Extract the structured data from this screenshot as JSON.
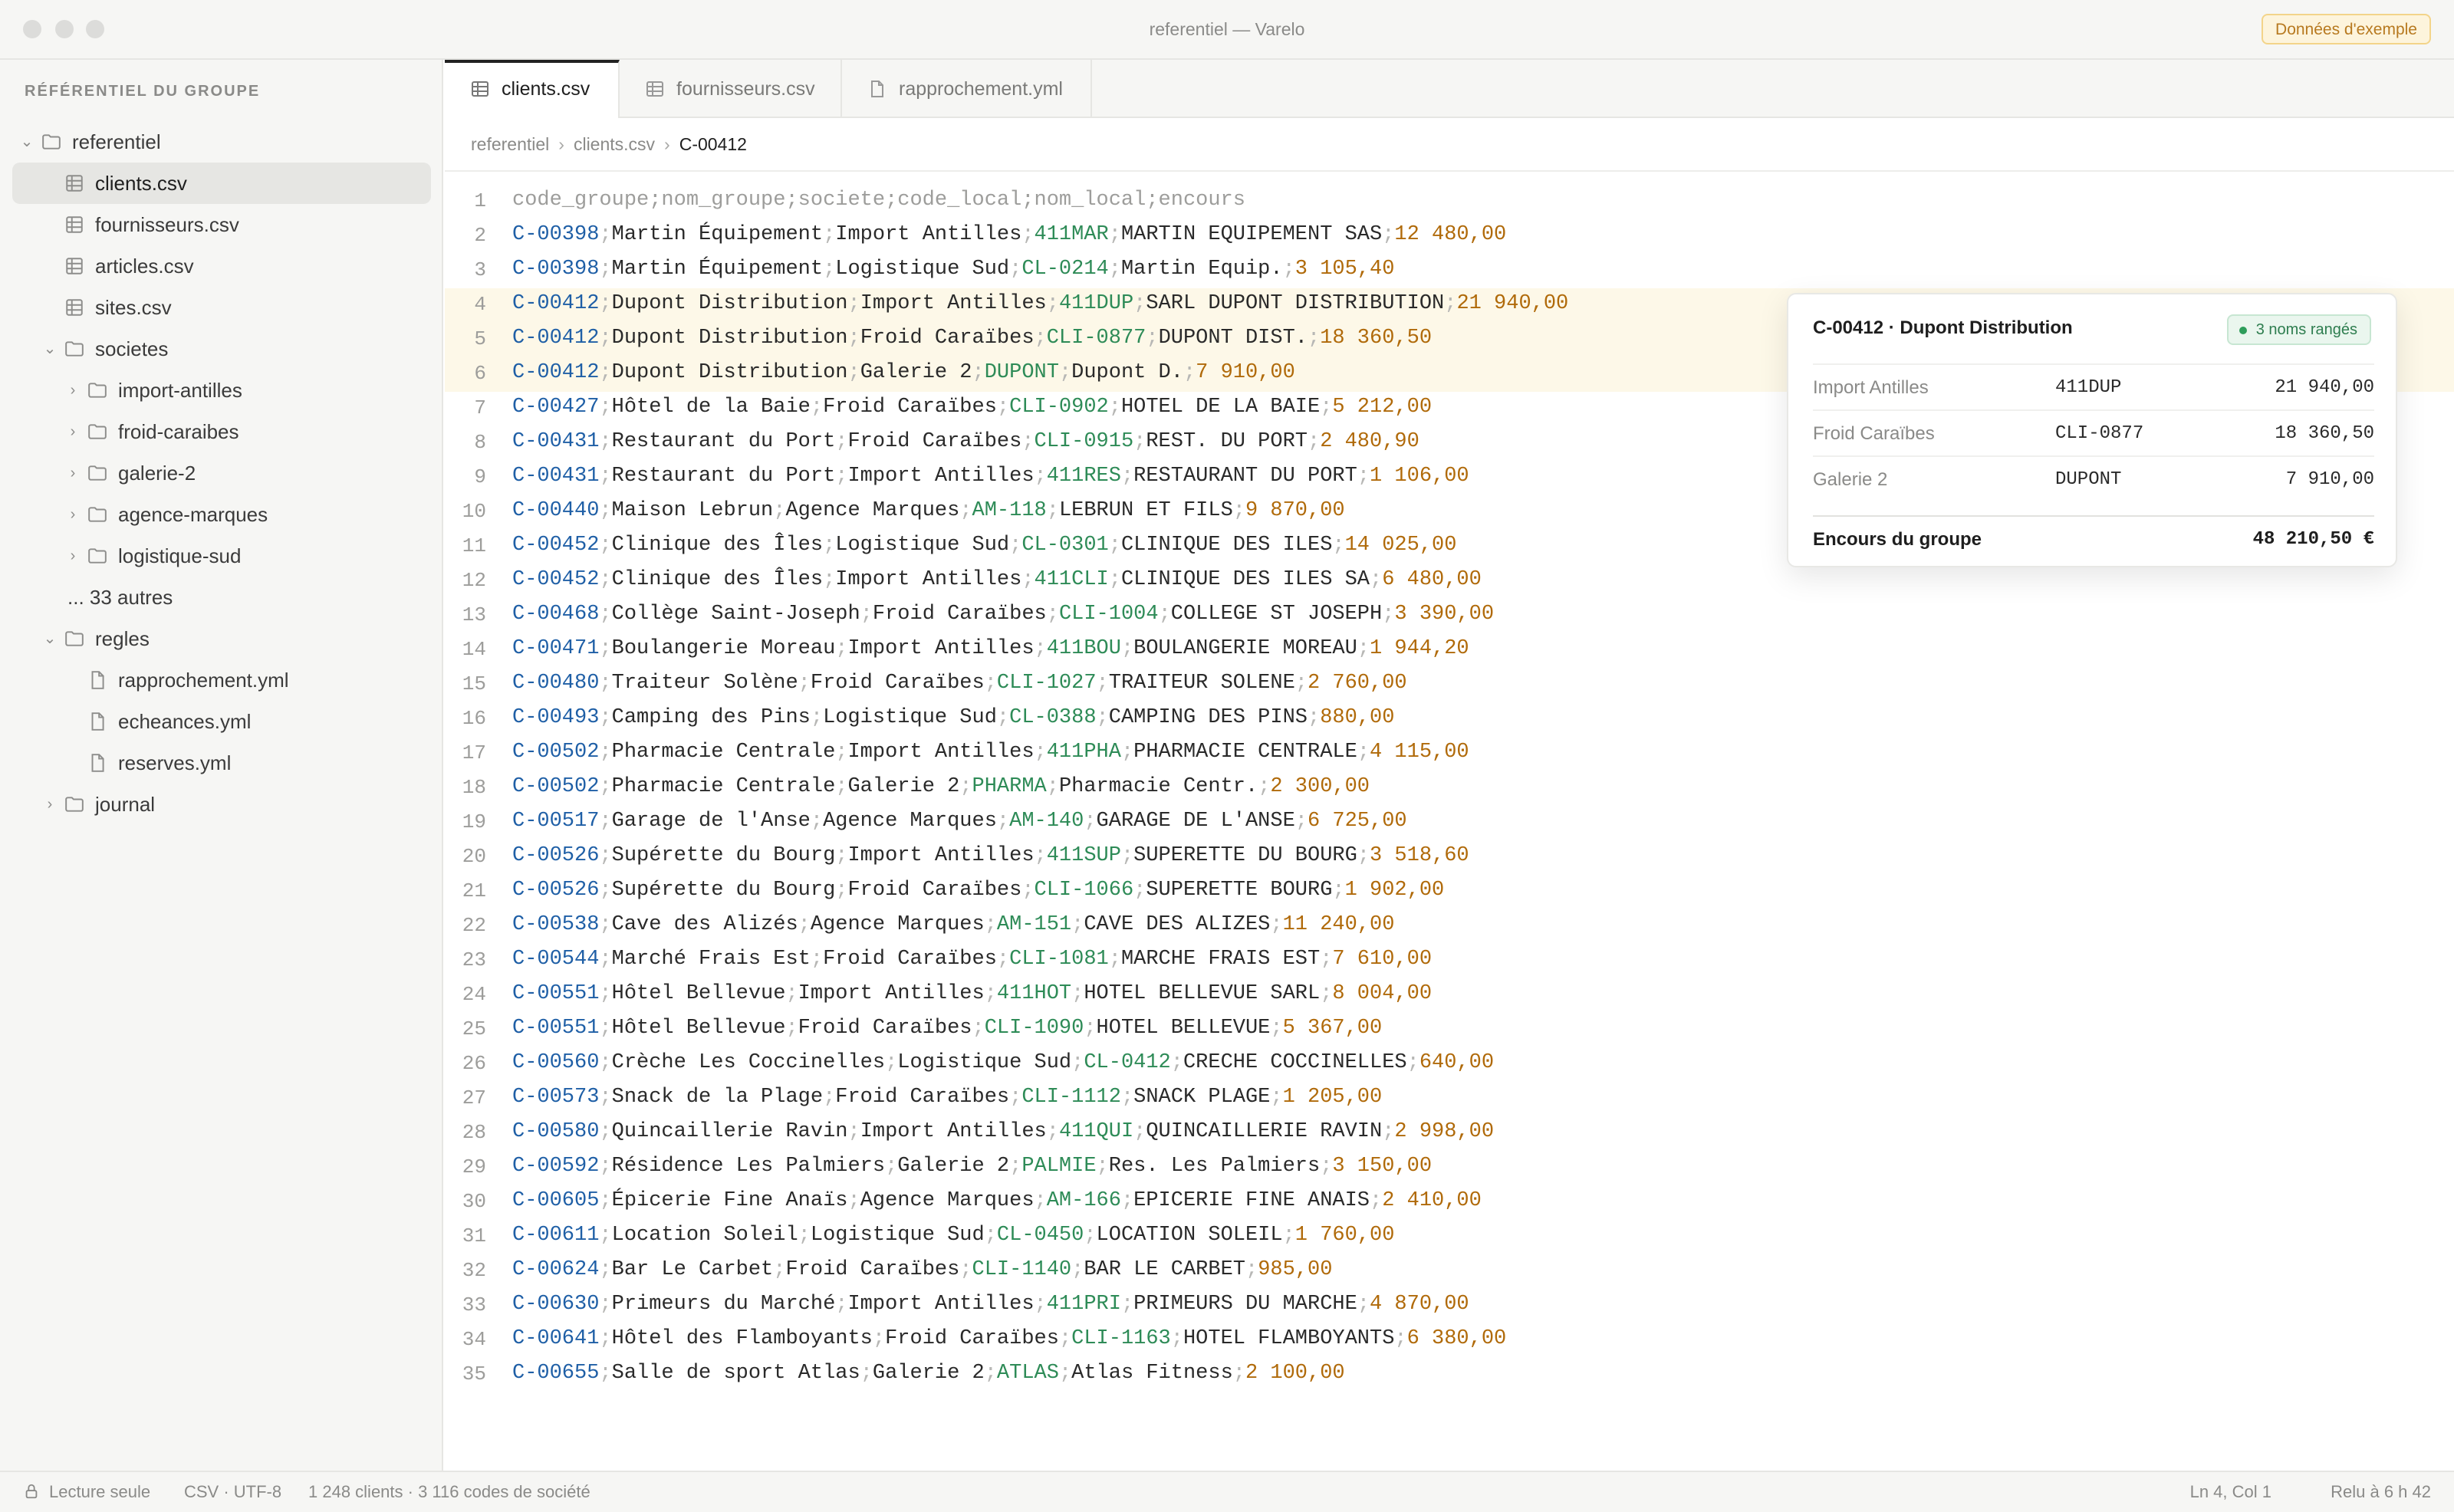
{
  "window": {
    "title": "referentiel — Varelo",
    "sample_badge": "Données d'exemple"
  },
  "sidebar": {
    "heading": "RÉFÉRENTIEL DU GROUPE",
    "tree": [
      {
        "label": "referentiel",
        "type": "folder",
        "depth": 0,
        "expanded": true
      },
      {
        "label": "clients.csv",
        "type": "table",
        "depth": 1,
        "selected": true
      },
      {
        "label": "fournisseurs.csv",
        "type": "table",
        "depth": 1
      },
      {
        "label": "articles.csv",
        "type": "table",
        "depth": 1
      },
      {
        "label": "sites.csv",
        "type": "table",
        "depth": 1
      },
      {
        "label": "societes",
        "type": "folder",
        "depth": 1,
        "expanded": true
      },
      {
        "label": "import-antilles",
        "type": "folder",
        "depth": 2,
        "expanded": false
      },
      {
        "label": "froid-caraibes",
        "type": "folder",
        "depth": 2,
        "expanded": false
      },
      {
        "label": "galerie-2",
        "type": "folder",
        "depth": 2,
        "expanded": false
      },
      {
        "label": "agence-marques",
        "type": "folder",
        "depth": 2,
        "expanded": false
      },
      {
        "label": "logistique-sud",
        "type": "folder",
        "depth": 2,
        "expanded": false
      },
      {
        "label": "... 33 autres",
        "type": "more",
        "depth": 2
      },
      {
        "label": "regles",
        "type": "folder",
        "depth": 1,
        "expanded": true
      },
      {
        "label": "rapprochement.yml",
        "type": "file",
        "depth": 2
      },
      {
        "label": "echeances.yml",
        "type": "file",
        "depth": 2
      },
      {
        "label": "reserves.yml",
        "type": "file",
        "depth": 2
      },
      {
        "label": "journal",
        "type": "folder",
        "depth": 1,
        "expanded": false
      }
    ]
  },
  "tabs": [
    {
      "label": "clients.csv",
      "icon": "table-icon",
      "active": true
    },
    {
      "label": "fournisseurs.csv",
      "icon": "table-icon",
      "active": false
    },
    {
      "label": "rapprochement.yml",
      "icon": "file-icon",
      "active": false
    }
  ],
  "breadcrumb": [
    "referentiel",
    "clients.csv",
    "C-00412"
  ],
  "editor": {
    "header": "code_groupe;nom_groupe;societe;code_local;nom_local;encours",
    "highlighted_lines": [
      4,
      5,
      6
    ],
    "rows": [
      [
        "C-00398",
        "Martin Équipement",
        "Import Antilles",
        "411MAR",
        "MARTIN EQUIPEMENT SAS",
        "12 480,00"
      ],
      [
        "C-00398",
        "Martin Équipement",
        "Logistique Sud",
        "CL-0214",
        "Martin Equip.",
        "3 105,40"
      ],
      [
        "C-00412",
        "Dupont Distribution",
        "Import Antilles",
        "411DUP",
        "SARL DUPONT DISTRIBUTION",
        "21 940,00"
      ],
      [
        "C-00412",
        "Dupont Distribution",
        "Froid Caraïbes",
        "CLI-0877",
        "DUPONT DIST.",
        "18 360,50"
      ],
      [
        "C-00412",
        "Dupont Distribution",
        "Galerie 2",
        "DUPONT",
        "Dupont D.",
        "7 910,00"
      ],
      [
        "C-00427",
        "Hôtel de la Baie",
        "Froid Caraïbes",
        "CLI-0902",
        "HOTEL DE LA BAIE",
        "5 212,00"
      ],
      [
        "C-00431",
        "Restaurant du Port",
        "Froid Caraïbes",
        "CLI-0915",
        "REST. DU PORT",
        "2 480,90"
      ],
      [
        "C-00431",
        "Restaurant du Port",
        "Import Antilles",
        "411RES",
        "RESTAURANT DU PORT",
        "1 106,00"
      ],
      [
        "C-00440",
        "Maison Lebrun",
        "Agence Marques",
        "AM-118",
        "LEBRUN ET FILS",
        "9 870,00"
      ],
      [
        "C-00452",
        "Clinique des Îles",
        "Logistique Sud",
        "CL-0301",
        "CLINIQUE DES ILES",
        "14 025,00"
      ],
      [
        "C-00452",
        "Clinique des Îles",
        "Import Antilles",
        "411CLI",
        "CLINIQUE DES ILES SA",
        "6 480,00"
      ],
      [
        "C-00468",
        "Collège Saint-Joseph",
        "Froid Caraïbes",
        "CLI-1004",
        "COLLEGE ST JOSEPH",
        "3 390,00"
      ],
      [
        "C-00471",
        "Boulangerie Moreau",
        "Import Antilles",
        "411BOU",
        "BOULANGERIE MOREAU",
        "1 944,20"
      ],
      [
        "C-00480",
        "Traiteur Solène",
        "Froid Caraïbes",
        "CLI-1027",
        "TRAITEUR SOLENE",
        "2 760,00"
      ],
      [
        "C-00493",
        "Camping des Pins",
        "Logistique Sud",
        "CL-0388",
        "CAMPING DES PINS",
        "880,00"
      ],
      [
        "C-00502",
        "Pharmacie Centrale",
        "Import Antilles",
        "411PHA",
        "PHARMACIE CENTRALE",
        "4 115,00"
      ],
      [
        "C-00502",
        "Pharmacie Centrale",
        "Galerie 2",
        "PHARMA",
        "Pharmacie Centr.",
        "2 300,00"
      ],
      [
        "C-00517",
        "Garage de l'Anse",
        "Agence Marques",
        "AM-140",
        "GARAGE DE L'ANSE",
        "6 725,00"
      ],
      [
        "C-00526",
        "Supérette du Bourg",
        "Import Antilles",
        "411SUP",
        "SUPERETTE DU BOURG",
        "3 518,60"
      ],
      [
        "C-00526",
        "Supérette du Bourg",
        "Froid Caraïbes",
        "CLI-1066",
        "SUPERETTE BOURG",
        "1 902,00"
      ],
      [
        "C-00538",
        "Cave des Alizés",
        "Agence Marques",
        "AM-151",
        "CAVE DES ALIZES",
        "11 240,00"
      ],
      [
        "C-00544",
        "Marché Frais Est",
        "Froid Caraïbes",
        "CLI-1081",
        "MARCHE FRAIS EST",
        "7 610,00"
      ],
      [
        "C-00551",
        "Hôtel Bellevue",
        "Import Antilles",
        "411HOT",
        "HOTEL BELLEVUE SARL",
        "8 004,00"
      ],
      [
        "C-00551",
        "Hôtel Bellevue",
        "Froid Caraïbes",
        "CLI-1090",
        "HOTEL BELLEVUE",
        "5 367,00"
      ],
      [
        "C-00560",
        "Crèche Les Coccinelles",
        "Logistique Sud",
        "CL-0412",
        "CRECHE COCCINELLES",
        "640,00"
      ],
      [
        "C-00573",
        "Snack de la Plage",
        "Froid Caraïbes",
        "CLI-1112",
        "SNACK PLAGE",
        "1 205,00"
      ],
      [
        "C-00580",
        "Quincaillerie Ravin",
        "Import Antilles",
        "411QUI",
        "QUINCAILLERIE RAVIN",
        "2 998,00"
      ],
      [
        "C-00592",
        "Résidence Les Palmiers",
        "Galerie 2",
        "PALMIE",
        "Res. Les Palmiers",
        "3 150,00"
      ],
      [
        "C-00605",
        "Épicerie Fine Anaïs",
        "Agence Marques",
        "AM-166",
        "EPICERIE FINE ANAIS",
        "2 410,00"
      ],
      [
        "C-00611",
        "Location Soleil",
        "Logistique Sud",
        "CL-0450",
        "LOCATION SOLEIL",
        "1 760,00"
      ],
      [
        "C-00624",
        "Bar Le Carbet",
        "Froid Caraïbes",
        "CLI-1140",
        "BAR LE CARBET",
        "985,00"
      ],
      [
        "C-00630",
        "Primeurs du Marché",
        "Import Antilles",
        "411PRI",
        "PRIMEURS DU MARCHE",
        "4 870,00"
      ],
      [
        "C-00641",
        "Hôtel des Flamboyants",
        "Froid Caraïbes",
        "CLI-1163",
        "HOTEL FLAMBOYANTS",
        "6 380,00"
      ],
      [
        "C-00655",
        "Salle de sport Atlas",
        "Galerie 2",
        "ATLAS",
        "Atlas Fitness",
        "2 100,00"
      ]
    ]
  },
  "popover": {
    "title": "C-00412 · Dupont Distribution",
    "badge": "3 noms rangés",
    "rows": [
      {
        "societe": "Import Antilles",
        "code": "411DUP",
        "amount": "21 940,00"
      },
      {
        "societe": "Froid Caraïbes",
        "code": "CLI-0877",
        "amount": "18 360,50"
      },
      {
        "societe": "Galerie 2",
        "code": "DUPONT",
        "amount": "7 910,00"
      }
    ],
    "total_label": "Encours du groupe",
    "total_amount": "48 210,50 €"
  },
  "status": {
    "mode": "Lecture seule",
    "encoding": "CSV · UTF-8",
    "counts": "1 248 clients · 3 116 codes de société",
    "position": "Ln 4, Col 1",
    "reread": "Relu à 6 h 42"
  },
  "colors": {
    "group_code": "#1f5fa6",
    "local_code": "#2e8b57",
    "amount": "#b06a0a",
    "highlight": "#fdf8e8"
  }
}
